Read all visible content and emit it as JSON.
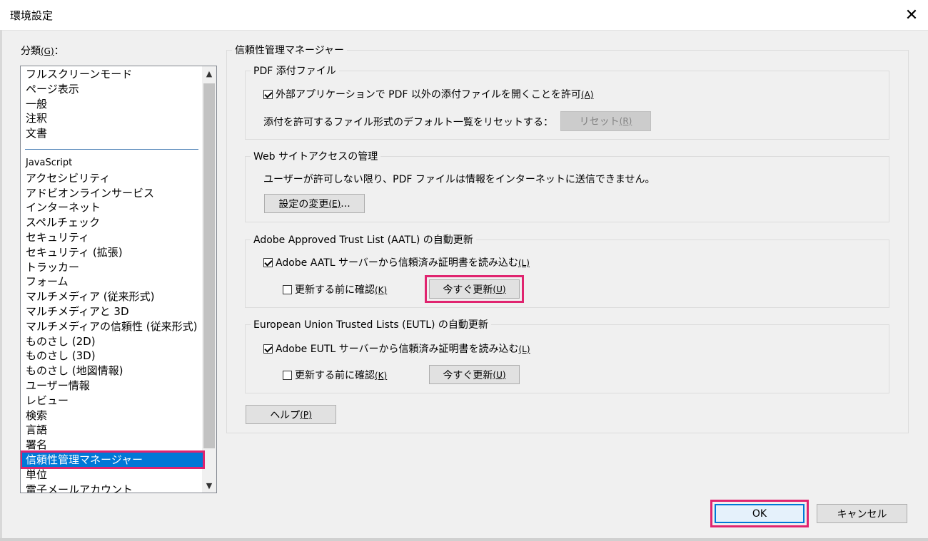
{
  "window": {
    "title": "環境設定"
  },
  "categories": {
    "label": "分類",
    "label_accel": "(G)",
    "label_suffix": "：",
    "group1": [
      "フルスクリーンモード",
      "ページ表示",
      "一般",
      "注釈",
      "文書"
    ],
    "group2": [
      "JavaScript",
      "アクセシビリティ",
      "アドビオンラインサービス",
      "インターネット",
      "スペルチェック",
      "セキュリティ",
      "セキュリティ (拡張)",
      "トラッカー",
      "フォーム",
      "マルチメディア (従来形式)",
      "マルチメディアと 3D",
      "マルチメディアの信頼性 (従来形式)",
      "ものさし (2D)",
      "ものさし (3D)",
      "ものさし (地図情報)",
      "ユーザー情報",
      "レビュー",
      "検索",
      "言語",
      "署名",
      "信頼性管理マネージャー",
      "単位",
      "電子メールアカウント"
    ],
    "selected": "信頼性管理マネージャー"
  },
  "panel": {
    "title": "信頼性管理マネージャー",
    "pdf_attach": {
      "legend": "PDF 添付ファイル",
      "allow_label": "外部アプリケーションで PDF 以外の添付ファイルを開くことを許可",
      "allow_accel": "(A)",
      "allow_checked": true,
      "reset_text": "添付を許可するファイル形式のデフォルト一覧をリセットする：",
      "reset_button": "リセット",
      "reset_accel": "(R)"
    },
    "web_access": {
      "legend": "Web サイトアクセスの管理",
      "info": "ユーザーが許可しない限り、PDF ファイルは情報をインターネットに送信できません。",
      "change_button": "設定の変更",
      "change_accel": "(E)",
      "change_suffix": "..."
    },
    "aatl": {
      "legend": "Adobe Approved Trust List (AATL) の自動更新",
      "load_label": "Adobe AATL サーバーから信頼済み証明書を読み込む",
      "load_accel": "(L)",
      "load_checked": true,
      "confirm_label": "更新する前に確認",
      "confirm_accel": "(K)",
      "confirm_checked": false,
      "update_button": "今すぐ更新",
      "update_accel": "(U)"
    },
    "eutl": {
      "legend": "European Union Trusted Lists (EUTL) の自動更新",
      "load_label": "Adobe EUTL サーバーから信頼済み証明書を読み込む",
      "load_accel": "(L)",
      "load_checked": true,
      "confirm_label": "更新する前に確認",
      "confirm_accel": "(K)",
      "confirm_checked": false,
      "update_button": "今すぐ更新",
      "update_accel": "(U)"
    },
    "help_button": "ヘルプ",
    "help_accel": "(P)"
  },
  "footer": {
    "ok": "OK",
    "cancel": "キャンセル"
  },
  "colors": {
    "selection": "#0078d7",
    "highlight": "#e0246f"
  }
}
